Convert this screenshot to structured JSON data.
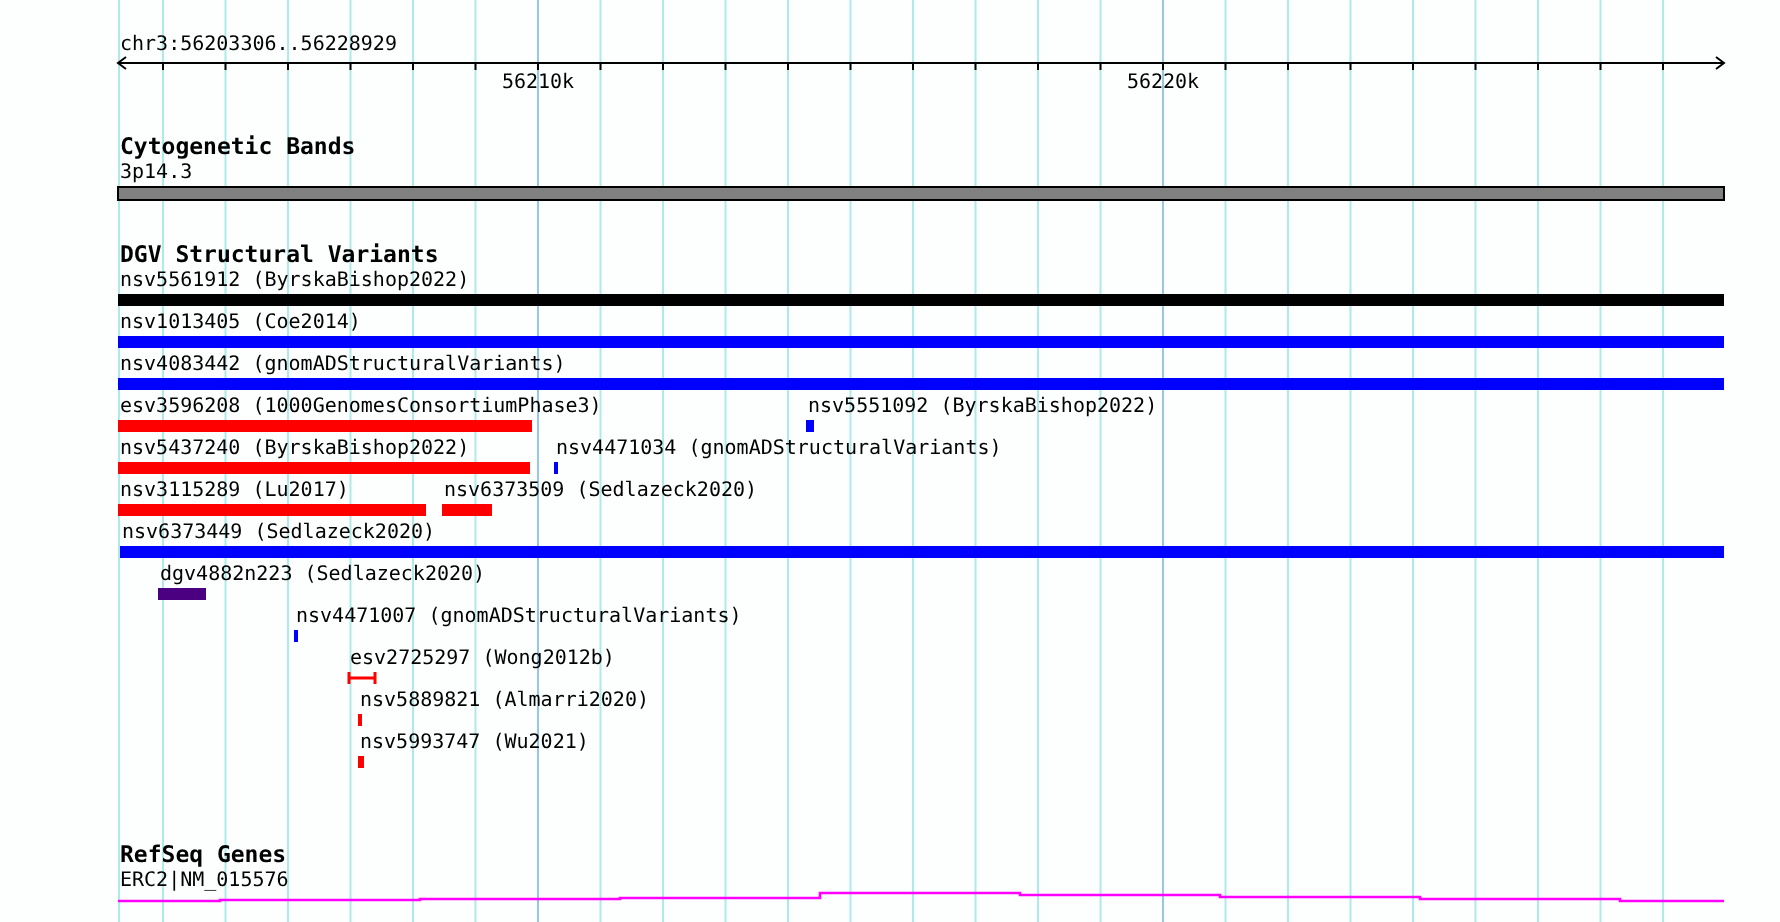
{
  "ruler": {
    "location": "chr3:56203306..56228929",
    "tick_labels": [
      "56210k",
      "56220k"
    ]
  },
  "cytogenetic_bands": {
    "title": "Cytogenetic Bands",
    "band": "3p14.3"
  },
  "dgv_structural_variants": {
    "title": "DGV Structural Variants",
    "features": [
      {
        "label": "nsv5561912 (ByrskaBishop2022)",
        "color": "#000000",
        "kind": "bar"
      },
      {
        "label": "nsv1013405 (Coe2014)",
        "color": "#0000ff",
        "kind": "bar"
      },
      {
        "label": "nsv4083442 (gnomADStructuralVariants)",
        "color": "#0000ff",
        "kind": "bar"
      },
      {
        "label": "esv3596208 (1000GenomesConsortiumPhase3)",
        "color": "#ff0000",
        "kind": "bar"
      },
      {
        "label": "nsv5551092 (ByrskaBishop2022)",
        "color": "#0000ff",
        "kind": "bar"
      },
      {
        "label": "nsv5437240 (ByrskaBishop2022)",
        "color": "#ff0000",
        "kind": "bar"
      },
      {
        "label": "nsv4471034 (gnomADStructuralVariants)",
        "color": "#0000ff",
        "kind": "bar"
      },
      {
        "label": "nsv3115289 (Lu2017)",
        "color": "#ff0000",
        "kind": "bar"
      },
      {
        "label": "nsv6373509 (Sedlazeck2020)",
        "color": "#ff0000",
        "kind": "bar"
      },
      {
        "label": "nsv6373449 (Sedlazeck2020)",
        "color": "#0000ff",
        "kind": "bar"
      },
      {
        "label": "dgv4882n223 (Sedlazeck2020)",
        "color": "#4b0082",
        "kind": "bar"
      },
      {
        "label": "nsv4471007 (gnomADStructuralVariants)",
        "color": "#0000ff",
        "kind": "bar"
      },
      {
        "label": "esv2725297 (Wong2012b)",
        "color": "#ff0000",
        "kind": "interval"
      },
      {
        "label": "nsv5889821 (Almarri2020)",
        "color": "#ff0000",
        "kind": "bar"
      },
      {
        "label": "nsv5993747 (Wu2021)",
        "color": "#ff0000",
        "kind": "bar"
      }
    ]
  },
  "refseq_genes": {
    "title": "RefSeq Genes",
    "gene": "ERC2|NM_015576"
  }
}
